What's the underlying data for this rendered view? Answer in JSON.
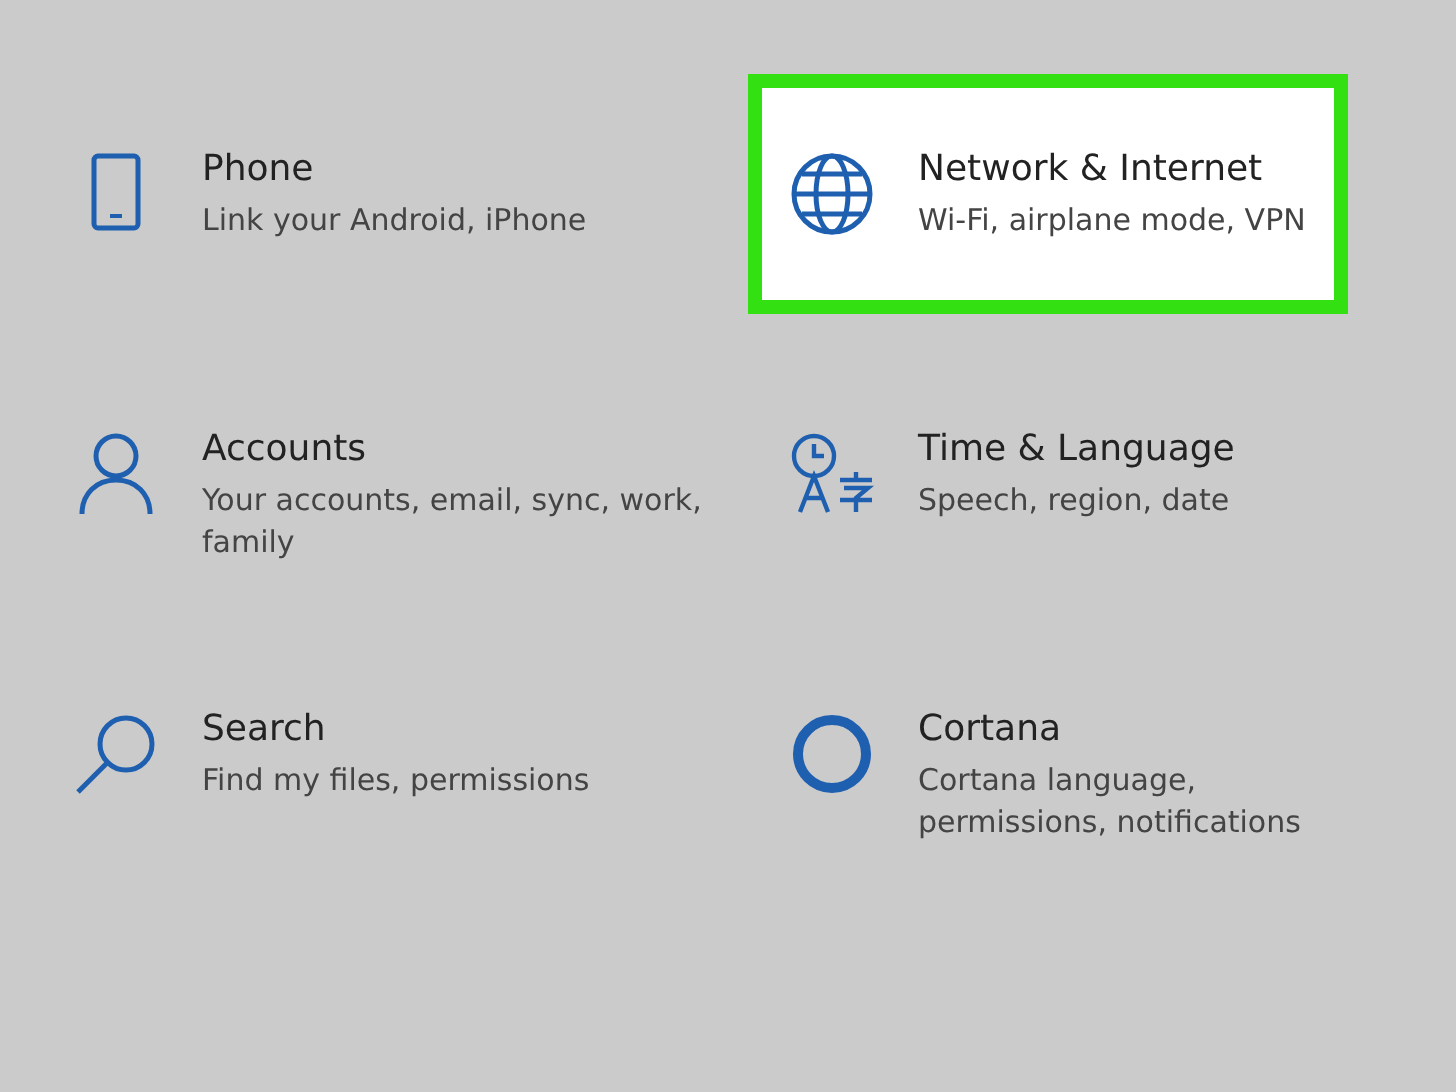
{
  "settings": [
    {
      "kind": "phone",
      "title": "Phone",
      "subtitle": "Link your Android, iPhone",
      "highlighted": false
    },
    {
      "kind": "network",
      "title": "Network & Internet",
      "subtitle": "Wi-Fi, airplane mode, VPN",
      "highlighted": true
    },
    {
      "kind": "accounts",
      "title": "Accounts",
      "subtitle": "Your accounts, email, sync, work, family",
      "highlighted": false
    },
    {
      "kind": "time",
      "title": "Time & Language",
      "subtitle": "Speech, region, date",
      "highlighted": false
    },
    {
      "kind": "search",
      "title": "Search",
      "subtitle": "Find my files, permissions",
      "highlighted": false
    },
    {
      "kind": "cortana",
      "title": "Cortana",
      "subtitle": "Cortana language, permissions, notifications",
      "highlighted": false
    }
  ]
}
